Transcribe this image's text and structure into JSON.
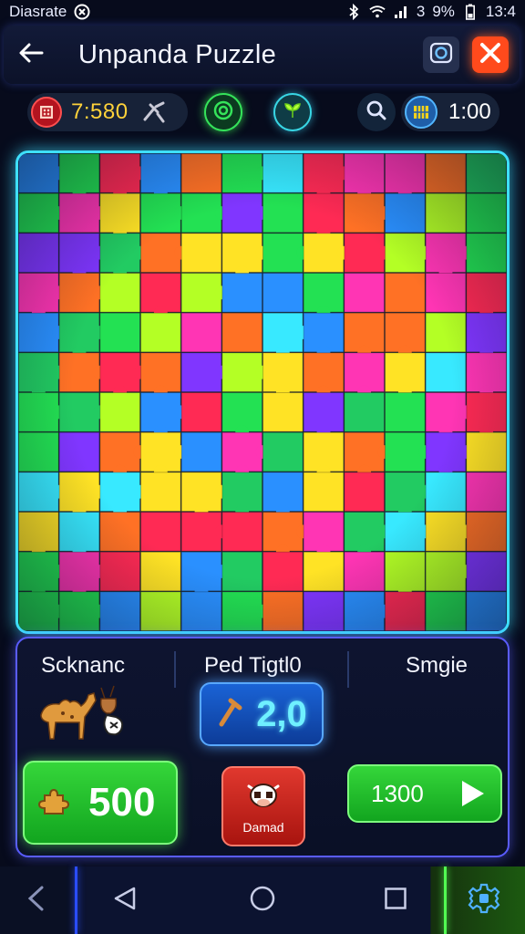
{
  "status_bar": {
    "carrier": "Diasrate",
    "battery": "9%",
    "time": "13:4",
    "signal_text": "3"
  },
  "header": {
    "title": "Unpanda Puzzle",
    "back_icon": "arrow-left-icon",
    "photo_icon": "camera-icon",
    "close_icon": "close-icon"
  },
  "stats": {
    "timer": "7:580",
    "score": "1:00"
  },
  "board": {
    "rows": 12,
    "cols": 12,
    "colors": [
      "#ff1f4b",
      "#ff2bb0",
      "#18e04a",
      "#ffe21a",
      "#1f8bff",
      "#2ee8ff",
      "#ff6a1a",
      "#7a2cff",
      "#b0ff1a",
      "#17c95a"
    ]
  },
  "panel": {
    "left_label": "Scknanc",
    "mid_label": "Ped Tigtl0",
    "right_label": "Smgie",
    "mid_value": "2,0",
    "btn_left_value": "500",
    "btn_mid_label": "Damad",
    "btn_right_value": "1300"
  },
  "colors": {
    "accent_cyan": "#3ee0ff",
    "accent_purple": "#5a5cff",
    "green": "#35d63a",
    "red": "#e0382e"
  }
}
